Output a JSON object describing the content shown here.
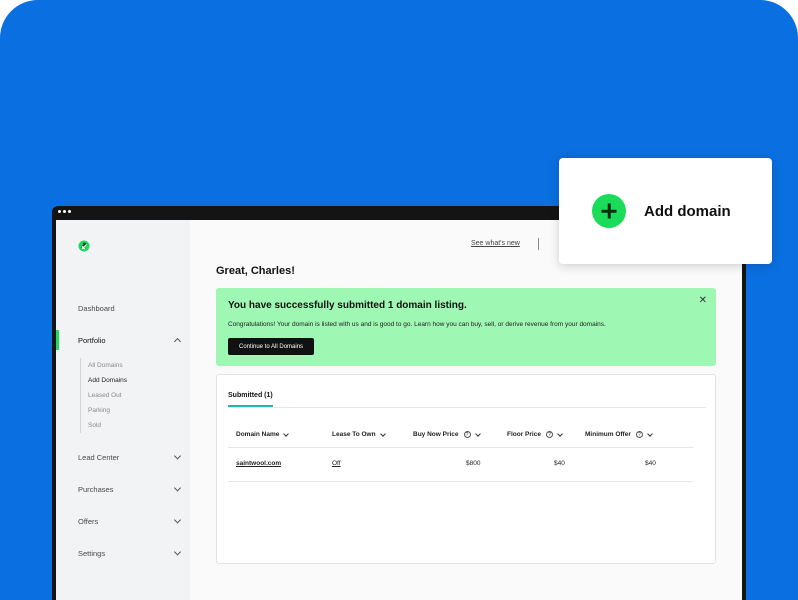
{
  "header": {
    "whats_new": "See what's new"
  },
  "greeting": "Great, Charles!",
  "sidebar": {
    "items": [
      {
        "label": "Dashboard"
      },
      {
        "label": "Portfolio"
      },
      {
        "label": "Lead Center"
      },
      {
        "label": "Purchases"
      },
      {
        "label": "Offers"
      },
      {
        "label": "Settings"
      }
    ],
    "portfolio_sub": [
      "All Domains",
      "Add Domains",
      "Leased Out",
      "Parking",
      "Sold"
    ]
  },
  "alert": {
    "title": "You have successfully submitted 1 domain listing.",
    "body": "Congratulations! Your domain is listed with us and is good to go. Learn how you can buy, sell, or derive revenue from your domains.",
    "button": "Continue to All Domains",
    "close": "✕"
  },
  "panel": {
    "tab": "Submitted (1)",
    "columns": [
      "Domain Name",
      "Lease To Own",
      "Buy Now Price",
      "Floor Price",
      "Minimum Offer"
    ],
    "help_icon": "?",
    "rows": [
      {
        "domain": "saintwool.com",
        "lease": "Off",
        "buy_now": "$800",
        "floor": "$40",
        "min_offer": "$40"
      }
    ]
  },
  "add_card": {
    "label": "Add domain"
  },
  "colors": {
    "background": "#0a6fe0",
    "accent": "#1bdb5a",
    "alert": "#9ef7b2",
    "tab": "#1fb8b0"
  }
}
